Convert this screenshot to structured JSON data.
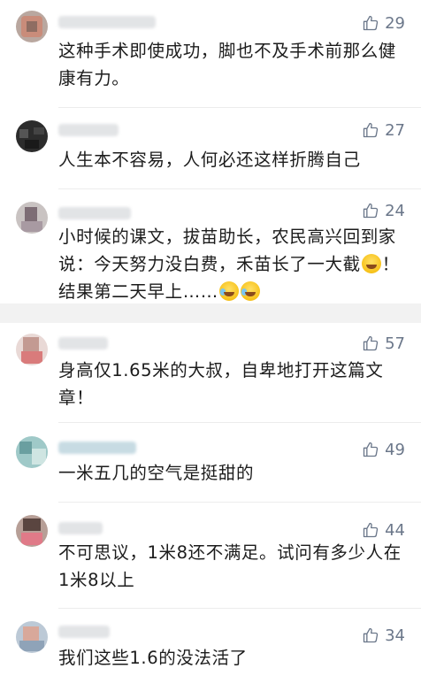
{
  "colors": {
    "like": "#6b778a",
    "text": "#1c1c1c",
    "separator": "#f2f2f2"
  },
  "icons": {
    "like": "thumbs-up-icon",
    "grin_emoji": "grinning-emoji-icon",
    "cry_laugh_emoji": "laughing-crying-emoji-icon"
  },
  "comments_top": [
    {
      "likes": "29",
      "text": "这种手术即使成功，脚也不及手术前那么健康有力。"
    },
    {
      "likes": "27",
      "text": "人生本不容易，人何必还这样折腾自己"
    },
    {
      "likes": "24",
      "text_a": "小时候的课文，拔苗助长，农民高兴回到家说：今天努力没白费，禾苗长了一大截",
      "text_b": "！结果第二天早上……"
    }
  ],
  "comments_bottom": [
    {
      "likes": "57",
      "text": "身高仅1.65米的大叔，自卑地打开这篇文章！"
    },
    {
      "likes": "49",
      "text": "一米五几的空气是挺甜的"
    },
    {
      "likes": "44",
      "text": "不可思议，1米8还不满足。试问有多少人在1米8以上"
    },
    {
      "likes": "34",
      "text": "我们这些1.6的没法活了"
    }
  ]
}
